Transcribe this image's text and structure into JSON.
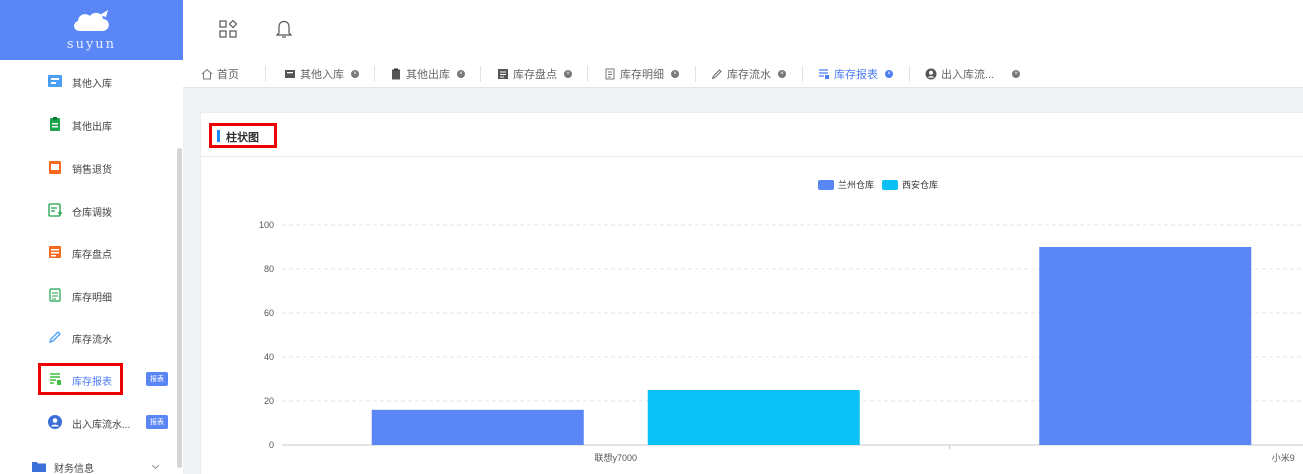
{
  "brand": {
    "name": "suyun"
  },
  "sidebar": {
    "items": [
      {
        "label": "其他入库",
        "icon": "stock-in-icon",
        "color": "#4a9ff5"
      },
      {
        "label": "其他出库",
        "icon": "clipboard-icon",
        "color": "#1aa34a"
      },
      {
        "label": "销售退货",
        "icon": "return-box-icon",
        "color": "#f56a1f"
      },
      {
        "label": "仓库调拨",
        "icon": "transfer-doc-icon",
        "color": "#1aa34a"
      },
      {
        "label": "库存盘点",
        "icon": "inventory-check-icon",
        "color": "#f56a1f"
      },
      {
        "label": "库存明细",
        "icon": "detail-list-icon",
        "color": "#1aa34a"
      },
      {
        "label": "库存流水",
        "icon": "pencil-icon",
        "color": "#4a9ff5"
      },
      {
        "label": "库存报表",
        "icon": "report-icon",
        "color": "#3fbf3f",
        "badge": "报表"
      },
      {
        "label": "出入库流水...",
        "icon": "user-circle-icon",
        "color": "#3b6fd8",
        "badge": "报表"
      }
    ],
    "group": {
      "label": "财务信息",
      "icon": "folder-icon"
    }
  },
  "tabs": [
    {
      "label": "首页",
      "icon": "home-icon"
    },
    {
      "label": "其他入库",
      "icon": "stock-in-icon"
    },
    {
      "label": "其他出库",
      "icon": "clipboard-icon"
    },
    {
      "label": "库存盘点",
      "icon": "inventory-check-icon"
    },
    {
      "label": "库存明细",
      "icon": "detail-list-icon"
    },
    {
      "label": "库存流水",
      "icon": "pencil-icon"
    },
    {
      "label": "库存报表",
      "icon": "report-icon"
    },
    {
      "label": "出入库流...",
      "icon": "user-circle-icon"
    }
  ],
  "active_tab": "库存报表",
  "card": {
    "title": "柱状图"
  },
  "colors": {
    "accent": "#5b86f6",
    "highlight": "#e00000",
    "series1": "#5b86f6",
    "series2": "#0ac0f5"
  },
  "chart_data": {
    "type": "bar",
    "categories": [
      "联想y7000",
      "小米9"
    ],
    "series": [
      {
        "name": "兰州仓库",
        "values": [
          16,
          90
        ]
      },
      {
        "name": "西安仓库",
        "values": [
          25,
          0
        ]
      }
    ],
    "ylim": [
      0,
      100
    ],
    "yticks": [
      "0",
      "20",
      "40",
      "60",
      "80",
      "100"
    ],
    "grid": true,
    "legend": "top-center"
  }
}
